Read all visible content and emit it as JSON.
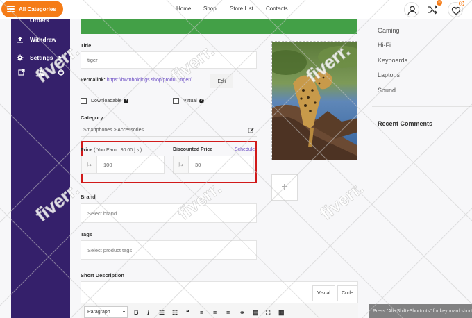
{
  "topbar": {
    "all_categories": "All Categories",
    "nav": [
      "Home",
      "Shop",
      "Store List",
      "Contacts"
    ],
    "compare_count": "0",
    "wishlist_count": "0"
  },
  "sidebar": {
    "items": [
      "Orders",
      "Withdraw",
      "Settings"
    ]
  },
  "form": {
    "title_label": "Title",
    "title_value": "tiger",
    "permalink_label": "Permalink:",
    "permalink_url": "https://hwmholdings.shop/product/tiger/",
    "edit_label": "Edit",
    "downloadable_label": "Downloadable",
    "virtual_label": "Virtual",
    "category_label": "Category",
    "category_value": "Smartphones > Accessories",
    "price_label": "Price",
    "price_earn": "( You Earn : 30.00 د.إ )",
    "currency": "د.إ",
    "price_value": "100",
    "discount_label": "Discounted Price",
    "schedule_label": "Schedule",
    "discount_value": "30",
    "brand_label": "Brand",
    "brand_placeholder": "Select brand",
    "tags_label": "Tags",
    "tags_placeholder": "Select product tags",
    "short_desc_label": "Short Description",
    "tab_visual": "Visual",
    "tab_code": "Code",
    "paragraph": "Paragraph"
  },
  "right": {
    "categories": [
      "Gaming",
      "Hi-Fi",
      "Keyboards",
      "Laptops",
      "Sound"
    ],
    "recent_comments": "Recent Comments"
  },
  "overlay": {
    "press_hint": "Press \"Alt+Shift+Shortcuts\" for keyboard shortcuts",
    "watermark": "fiverr."
  },
  "colors": {
    "accent": "#f57c17",
    "sidebar": "#35206b",
    "success": "#43a047",
    "highlight": "#d11a1a",
    "link": "#6a4bc4"
  }
}
